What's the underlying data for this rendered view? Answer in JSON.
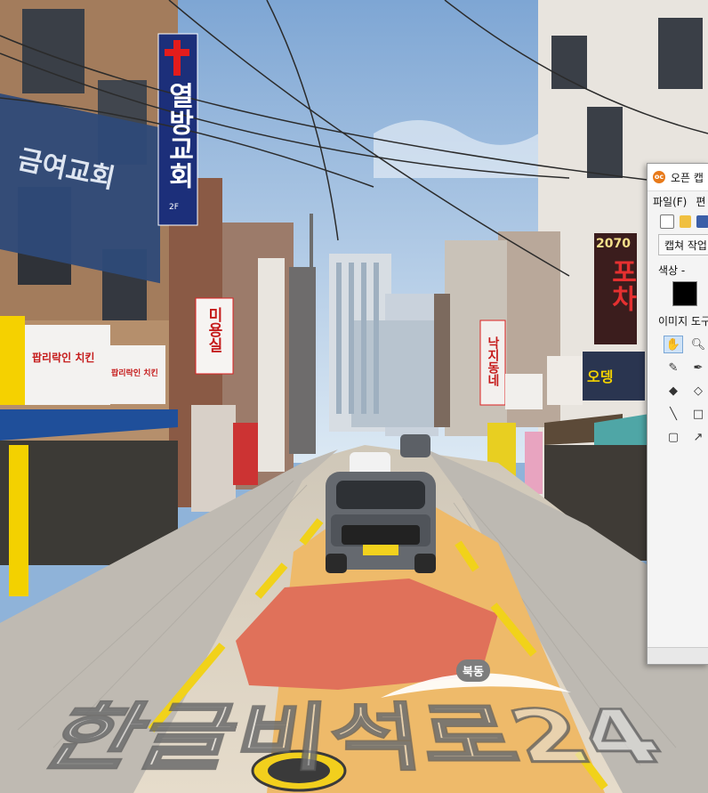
{
  "scene": {
    "signs": {
      "church_vertical": "열방교회",
      "church_floor": "2F",
      "church_wall": "금여교회",
      "chicken_1": "팝리락인 치킨",
      "chicken_2": "팝리락인 치킨",
      "beauty": "미용실",
      "pocha_number": "2070",
      "pocha": "포차",
      "nakji": "낙지동네",
      "right_shop": "오뎅"
    },
    "road_text": "한글비석로24",
    "direction_badge": "북동"
  },
  "capture_app": {
    "title": "오픈 캡",
    "logo": "oc",
    "menu": [
      "파일(F)",
      "편"
    ],
    "capture_button": "캡쳐 작업",
    "color_label": "색상 -",
    "image_tools_label": "이미지 도구",
    "tools": [
      {
        "icon": "hand-icon",
        "glyph": "✋",
        "active": true
      },
      {
        "icon": "magnifier-icon",
        "glyph": "🔍︎",
        "active": false
      },
      {
        "icon": "pencil-icon",
        "glyph": "✎",
        "active": false
      },
      {
        "icon": "brush-icon",
        "glyph": "✒",
        "active": false
      },
      {
        "icon": "paint-bucket-icon",
        "glyph": "◆",
        "active": false
      },
      {
        "icon": "eraser-icon",
        "glyph": "◇",
        "active": false
      },
      {
        "icon": "line-icon",
        "glyph": "╲",
        "active": false
      },
      {
        "icon": "rectangle-icon",
        "glyph": "□",
        "active": false
      },
      {
        "icon": "rounded-rectangle-icon",
        "glyph": "▢",
        "active": false
      },
      {
        "icon": "color-picker-icon",
        "glyph": "↗",
        "active": false
      }
    ],
    "swatch_color": "#000000"
  }
}
